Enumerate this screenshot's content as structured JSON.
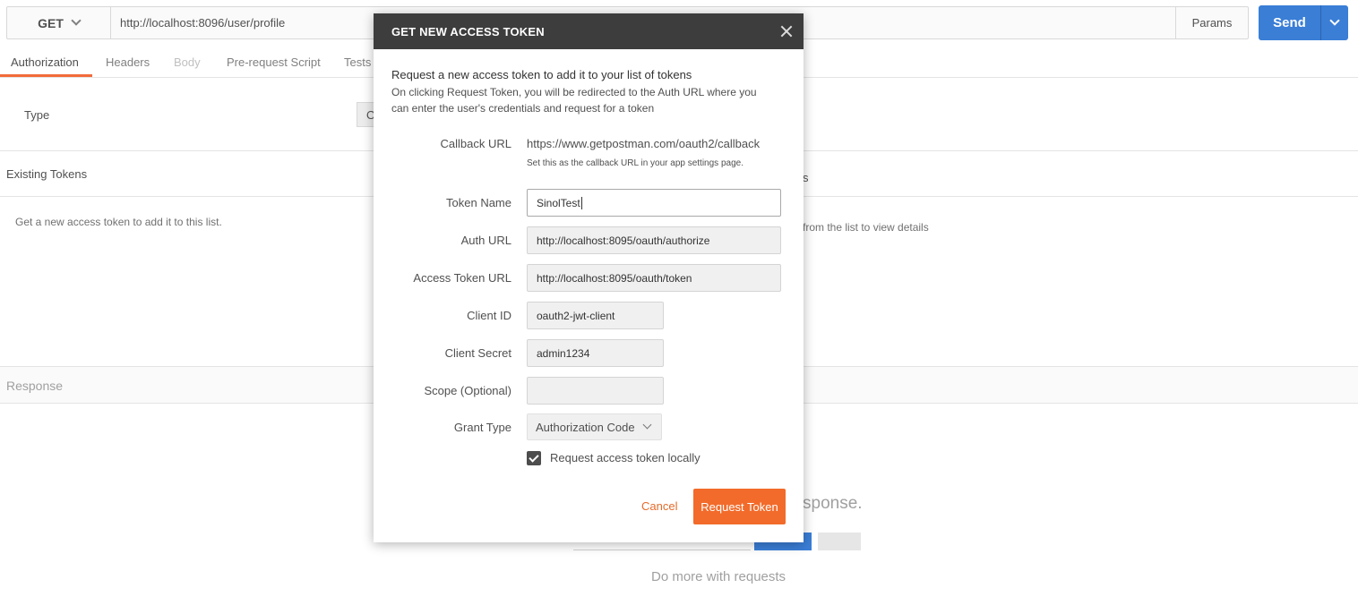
{
  "request": {
    "method": "GET",
    "url": "http://localhost:8096/user/profile",
    "params_label": "Params",
    "send_label": "Send"
  },
  "tabs": [
    {
      "label": "Authorization",
      "active": true
    },
    {
      "label": "Headers",
      "active": false
    },
    {
      "label": "Body",
      "active": false
    },
    {
      "label": "Pre-request Script",
      "active": false
    },
    {
      "label": "Tests",
      "active": false
    }
  ],
  "auth": {
    "type_label": "Type",
    "type_value_fragment": "O"
  },
  "tokens": {
    "existing_label": "Existing Tokens",
    "empty_hint": "Get a new access token to add it to this list.",
    "details_fragment": "s",
    "select_hint_fragment": "from the list to view details"
  },
  "response": {
    "label": "Response",
    "hit_send_fragment": "sponse.",
    "do_more": "Do more with requests"
  },
  "modal": {
    "title": "GET NEW ACCESS TOKEN",
    "intro_title": "Request a new access token to add it to your list of tokens",
    "intro_desc": "On clicking Request Token, you will be redirected to the Auth URL where you can enter the user's credentials and request for a token",
    "callback_label": "Callback URL",
    "callback_value": "https://www.getpostman.com/oauth2/callback",
    "callback_hint": "Set this as the callback URL in your app settings page.",
    "token_name_label": "Token Name",
    "token_name_value": "SinolTest",
    "auth_url_label": "Auth URL",
    "auth_url_value": "http://localhost:8095/oauth/authorize",
    "access_token_url_label": "Access Token URL",
    "access_token_url_value": "http://localhost:8095/oauth/token",
    "client_id_label": "Client ID",
    "client_id_value": "oauth2-jwt-client",
    "client_secret_label": "Client Secret",
    "client_secret_value": "admin1234",
    "scope_label": "Scope (Optional)",
    "scope_value": "",
    "grant_type_label": "Grant Type",
    "grant_type_value": "Authorization Code",
    "local_checkbox_label": "Request access token locally",
    "local_checkbox_checked": true,
    "cancel_label": "Cancel",
    "request_label": "Request Token"
  },
  "colors": {
    "accent": "#f26b2a",
    "send": "#3a7ed6",
    "modal_header": "#3d3d3d"
  }
}
